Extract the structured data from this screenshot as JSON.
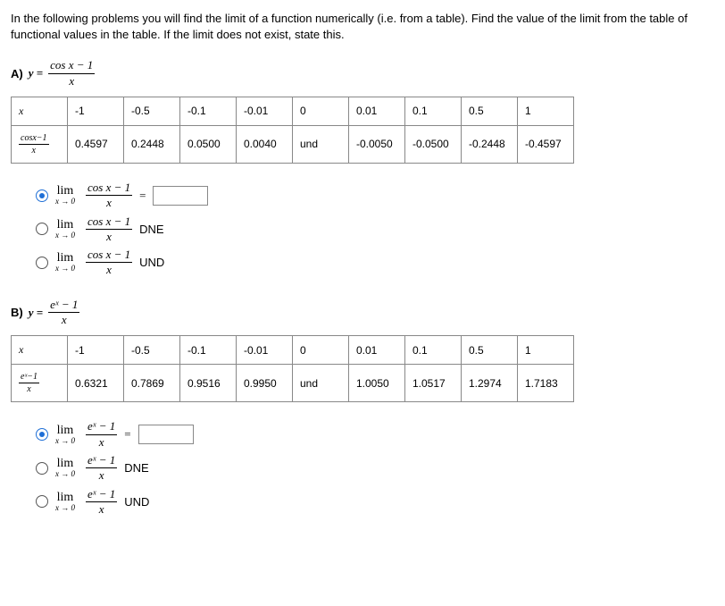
{
  "instructions": "In the following problems you will find the limit of a function numerically (i.e. from a table). Find the value of the limit from the table of functional values in the table. If the limit does not exist, state this.",
  "problemA": {
    "label": "A)",
    "y_eq": "y =",
    "func_num": "cos x − 1",
    "func_den": "x",
    "row_label_x": "x",
    "row_label_f_num": "cosx−1",
    "row_label_f_den": "x",
    "xs": [
      "-1",
      "-0.5",
      "-0.1",
      "-0.01",
      "0",
      "0.01",
      "0.1",
      "0.5",
      "1"
    ],
    "vals": [
      "0.4597",
      "0.2448",
      "0.0500",
      "0.0040",
      "und",
      "-0.0050",
      "-0.0500",
      "-0.2448",
      "-0.4597"
    ],
    "options": {
      "lim_word": "lim",
      "lim_sub": "x → 0",
      "expr_num": "cos x − 1",
      "expr_den": "x",
      "eq_sign": "=",
      "opt1_rhs_is_input": true,
      "opt2_rhs": "DNE",
      "opt3_rhs": "UND",
      "selected": 1
    }
  },
  "problemB": {
    "label": "B)",
    "y_eq": "y =",
    "func_num": "eˣ − 1",
    "func_den": "x",
    "row_label_x": "x",
    "row_label_f_num": "eˣ−1",
    "row_label_f_den": "x",
    "xs": [
      "-1",
      "-0.5",
      "-0.1",
      "-0.01",
      "0",
      "0.01",
      "0.1",
      "0.5",
      "1"
    ],
    "vals": [
      "0.6321",
      "0.7869",
      "0.9516",
      "0.9950",
      "und",
      "1.0050",
      "1.0517",
      "1.2974",
      "1.7183"
    ],
    "options": {
      "lim_word": "lim",
      "lim_sub": "x → 0",
      "expr_num": "eˣ − 1",
      "expr_den": "x",
      "eq_sign": "=",
      "opt1_rhs_is_input": true,
      "opt2_rhs": "DNE",
      "opt3_rhs": "UND",
      "selected": 1
    }
  }
}
